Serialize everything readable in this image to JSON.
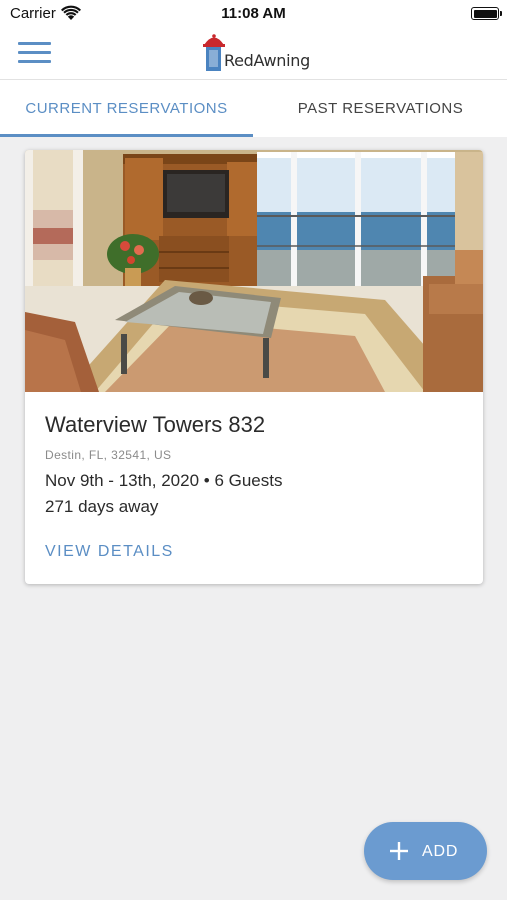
{
  "status_bar": {
    "carrier": "Carrier",
    "time": "11:08 AM",
    "icons": [
      "wifi-icon",
      "battery-icon"
    ]
  },
  "header": {
    "brand": "RedAwning",
    "menu_icon": "hamburger-icon"
  },
  "tabs": [
    {
      "label": "CURRENT RESERVATIONS",
      "active": true
    },
    {
      "label": "PAST RESERVATIONS",
      "active": false
    }
  ],
  "reservations": [
    {
      "name": "Waterview Towers 832",
      "address": "Destin, FL, 32541, US",
      "dates": "Nov 9th - 13th, 2020 • 6 Guests",
      "days_away": "271 days away",
      "action_label": "VIEW DETAILS"
    }
  ],
  "add_button": {
    "label": "ADD",
    "icon": "plus-icon"
  },
  "colors": {
    "accent": "#5b8ec4",
    "fab": "#6b9bd0",
    "background": "#efeff0",
    "brand_red": "#c8282d"
  }
}
